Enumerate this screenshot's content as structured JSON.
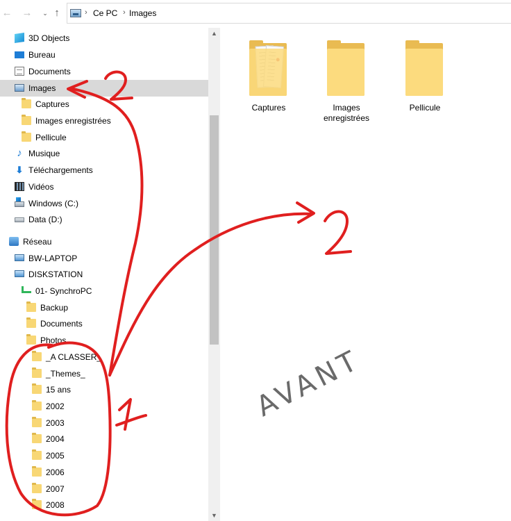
{
  "address_bar": {
    "nav": {
      "back_icon": "arrow-left-icon",
      "forward_icon": "arrow-right-icon",
      "recent_icon": "chevron-down-icon",
      "up_icon": "arrow-up-icon"
    },
    "location_icon": "pictures-icon",
    "breadcrumbs": [
      "Ce PC",
      "Images"
    ]
  },
  "navigation_pane": {
    "items": [
      {
        "label": "3D Objects",
        "icon": "3d-objects-icon",
        "indent": 0
      },
      {
        "label": "Bureau",
        "icon": "desktop-icon",
        "indent": 0
      },
      {
        "label": "Documents",
        "icon": "documents-icon",
        "indent": 0
      },
      {
        "label": "Images",
        "icon": "pictures-icon",
        "indent": 0,
        "selected": true
      },
      {
        "label": "Captures",
        "icon": "folder-icon",
        "indent": 1
      },
      {
        "label": "Images enregistrées",
        "icon": "folder-icon",
        "indent": 1
      },
      {
        "label": "Pellicule",
        "icon": "folder-icon",
        "indent": 1
      },
      {
        "label": "Musique",
        "icon": "music-icon",
        "indent": 0
      },
      {
        "label": "Téléchargements",
        "icon": "download-icon",
        "indent": 0
      },
      {
        "label": "Vidéos",
        "icon": "video-icon",
        "indent": 0
      },
      {
        "label": "Windows (C:)",
        "icon": "windows-drive-icon",
        "indent": 0
      },
      {
        "label": "Data (D:)",
        "icon": "drive-icon",
        "indent": 0
      },
      {
        "label": "Réseau",
        "icon": "network-icon",
        "indent": -1
      },
      {
        "label": "BW-LAPTOP",
        "icon": "computer-icon",
        "indent": 0
      },
      {
        "label": "DISKSTATION",
        "icon": "computer-icon",
        "indent": 0
      },
      {
        "label": "01- SynchroPC",
        "icon": "network-share-icon",
        "indent": 1
      },
      {
        "label": "Backup",
        "icon": "folder-icon",
        "indent": 2
      },
      {
        "label": "Documents",
        "icon": "folder-icon",
        "indent": 2
      },
      {
        "label": "Photos",
        "icon": "folder-icon",
        "indent": 2
      },
      {
        "label": "_A CLASSER_",
        "icon": "folder-icon",
        "indent": 3
      },
      {
        "label": "_Themes_",
        "icon": "folder-icon",
        "indent": 3
      },
      {
        "label": "15 ans",
        "icon": "folder-icon",
        "indent": 3
      },
      {
        "label": "2002",
        "icon": "folder-icon",
        "indent": 3
      },
      {
        "label": "2003",
        "icon": "folder-icon",
        "indent": 3
      },
      {
        "label": "2004",
        "icon": "folder-icon",
        "indent": 3
      },
      {
        "label": "2005",
        "icon": "folder-icon",
        "indent": 3
      },
      {
        "label": "2006",
        "icon": "folder-icon",
        "indent": 3
      },
      {
        "label": "2007",
        "icon": "folder-icon",
        "indent": 3
      },
      {
        "label": "2008",
        "icon": "folder-icon",
        "indent": 3
      }
    ]
  },
  "content": {
    "folders": [
      {
        "label": "Captures",
        "has_preview": true
      },
      {
        "label": "Images\nenregistrées",
        "has_preview": false
      },
      {
        "label": "Pellicule",
        "has_preview": false
      }
    ]
  },
  "annotations": {
    "handwritten_text": "AVANT",
    "markers": [
      "1",
      "2",
      "2"
    ],
    "marker_color": "#e01f1f"
  },
  "colors": {
    "selection": "#d9d9d9",
    "folder": "#f8d775",
    "accent": "#1e7dd6"
  }
}
